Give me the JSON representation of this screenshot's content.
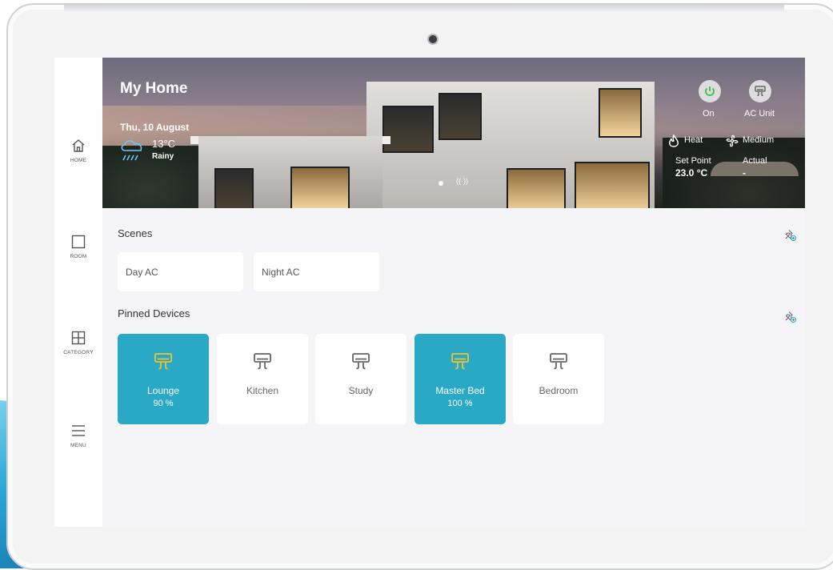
{
  "app": {
    "title": "My Home"
  },
  "nav": [
    {
      "label": "HOME",
      "icon": "home-icon"
    },
    {
      "label": "ROOM",
      "icon": "room-icon"
    },
    {
      "label": "CATEGORY",
      "icon": "category-icon"
    },
    {
      "label": "MENU",
      "icon": "menu-icon"
    }
  ],
  "hero": {
    "date": "Thu, 10 August",
    "temperature": "13°C",
    "condition": "Rainy",
    "weather_icon": "rain-cloud-icon",
    "power_label": "On",
    "unit_label": "AC Unit",
    "mode_label": "Heat",
    "fan_label": "Medium",
    "setpoint_label": "Set Point",
    "setpoint_value": "23.0 °C",
    "actual_label": "Actual",
    "actual_value": "-"
  },
  "scenes": {
    "title": "Scenes",
    "items": [
      "Day AC",
      "Night AC"
    ]
  },
  "pinned": {
    "title": "Pinned Devices",
    "items": [
      {
        "name": "Lounge",
        "value": "90 %",
        "active": true
      },
      {
        "name": "Kitchen",
        "value": "",
        "active": false
      },
      {
        "name": "Study",
        "value": "",
        "active": false
      },
      {
        "name": "Master Bed",
        "value": "100 %",
        "active": true
      },
      {
        "name": "Bedroom",
        "value": "",
        "active": false
      }
    ]
  },
  "colors": {
    "accent": "#2aa9c7",
    "active_icon": "#f2c230",
    "power_green": "#3cc24a"
  }
}
